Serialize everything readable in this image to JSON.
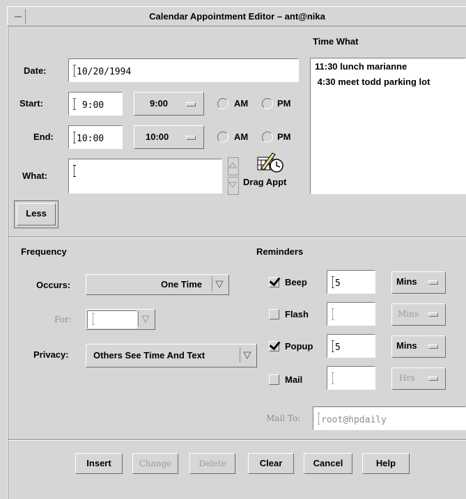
{
  "window": {
    "title": "Calendar Appointment Editor –  ant@nika"
  },
  "appointment": {
    "date_label": "Date:",
    "date_value": "10/20/1994",
    "start_label": "Start:",
    "start_value": " 9:00",
    "start_menu": "9:00",
    "end_label": "End:",
    "end_value": "10:00",
    "end_menu": "10:00",
    "am_label": "AM",
    "pm_label": "PM",
    "what_label": "What:",
    "what_value": "",
    "drag_label": "Drag Appt",
    "drag_icon": "drag-appointment-icon"
  },
  "list": {
    "header": "Time  What",
    "items": [
      "11:30 lunch marianne",
      " 4:30 meet todd parking lot"
    ]
  },
  "less_button": "Less",
  "frequency": {
    "heading": "Frequency",
    "occurs_label": "Occurs:",
    "occurs_value": "One Time",
    "for_label": "For:",
    "for_value": "",
    "privacy_label": "Privacy:",
    "privacy_value": "Others See Time And Text"
  },
  "reminders": {
    "heading": "Reminders",
    "items": [
      {
        "label": "Beep",
        "checked": true,
        "value": "5",
        "unit": "Mins",
        "enabled": true
      },
      {
        "label": "Flash",
        "checked": false,
        "value": "",
        "unit": "Mins",
        "enabled": false
      },
      {
        "label": "Popup",
        "checked": true,
        "value": "5",
        "unit": "Mins",
        "enabled": true
      },
      {
        "label": "Mail",
        "checked": false,
        "value": "",
        "unit": "Hrs",
        "enabled": false
      }
    ],
    "mail_to_label": "Mail To:",
    "mail_to_value": "root@hpdaily"
  },
  "buttons": {
    "insert": "Insert",
    "change": "Change",
    "delete": "Delete",
    "clear": "Clear",
    "cancel": "Cancel",
    "help": "Help"
  }
}
